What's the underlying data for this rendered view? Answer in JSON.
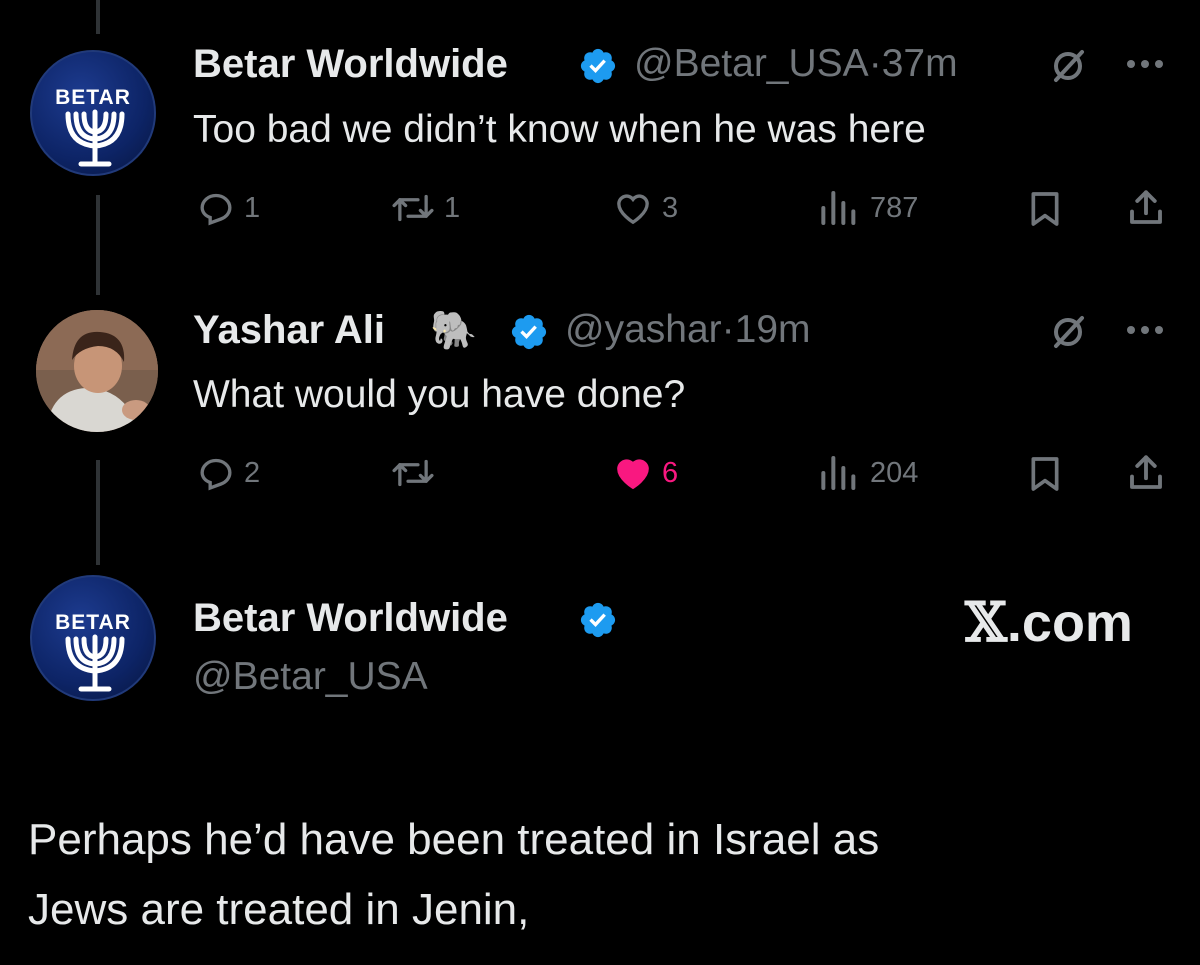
{
  "tweets": [
    {
      "avatar_text": "BETAR",
      "name": "Betar Worldwide",
      "handle": "@Betar_USA",
      "time": "37m",
      "text": "Too bad we didn’t know when he was here",
      "replies": "1",
      "reposts": "1",
      "likes": "3",
      "views": "787",
      "liked": false
    },
    {
      "name": "Yashar Ali",
      "name_emoji": "🐘",
      "handle": "@yashar",
      "time": "19m",
      "text": "What would you have done?",
      "replies": "2",
      "reposts": "",
      "likes": "6",
      "views": "204",
      "liked": true
    }
  ],
  "quote": {
    "avatar_text": "BETAR",
    "name": "Betar Worldwide",
    "handle": "@Betar_USA",
    "site_label_symbol": "𝕏",
    "site_label_rest": ".com",
    "text_line1": "Perhaps he’d have been treated in Israel as",
    "text_line2": "Jews are treated in Jenin,"
  },
  "separator": "·",
  "colors": {
    "background": "#000000",
    "text": "#e7e9ea",
    "muted": "#71767b",
    "verified": "#1d9bf0",
    "like": "#f91880"
  },
  "icons": [
    "reply-icon",
    "repost-icon",
    "like-icon",
    "views-icon",
    "bookmark-icon",
    "share-icon",
    "grok-icon",
    "more-icon",
    "verified-badge-icon",
    "menorah-icon"
  ]
}
